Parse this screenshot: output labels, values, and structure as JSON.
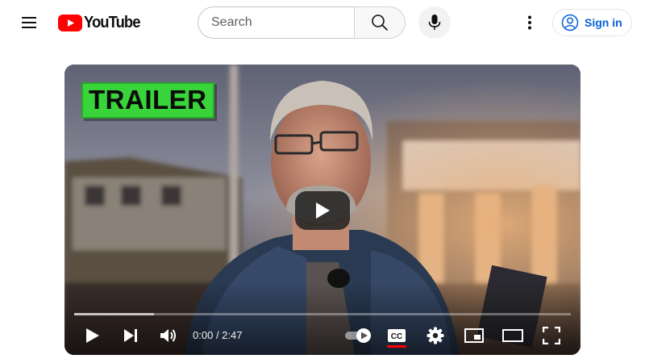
{
  "header": {
    "logo_text": "YouTube",
    "search_placeholder": "Search",
    "signin_label": "Sign in",
    "brand_red": "#ff0000",
    "link_blue": "#065fd4"
  },
  "player": {
    "badge_text": "TRAILER",
    "badge_color": "#39d43a",
    "current_time": "0:00",
    "duration": "2:47",
    "buffered_fraction": 0.16,
    "captions_on": true
  },
  "icons": {
    "menu": "hamburger-icon",
    "search": "search-icon",
    "mic": "microphone-icon",
    "more": "kebab-icon",
    "account": "account-circle-icon",
    "play": "play-icon",
    "next": "skip-next-icon",
    "volume": "volume-icon",
    "autoplay": "autoplay-toggle-icon",
    "captions": "closed-captions-icon",
    "settings": "gear-icon",
    "miniplayer": "miniplayer-icon",
    "theater": "theater-mode-icon",
    "fullscreen": "fullscreen-icon"
  }
}
